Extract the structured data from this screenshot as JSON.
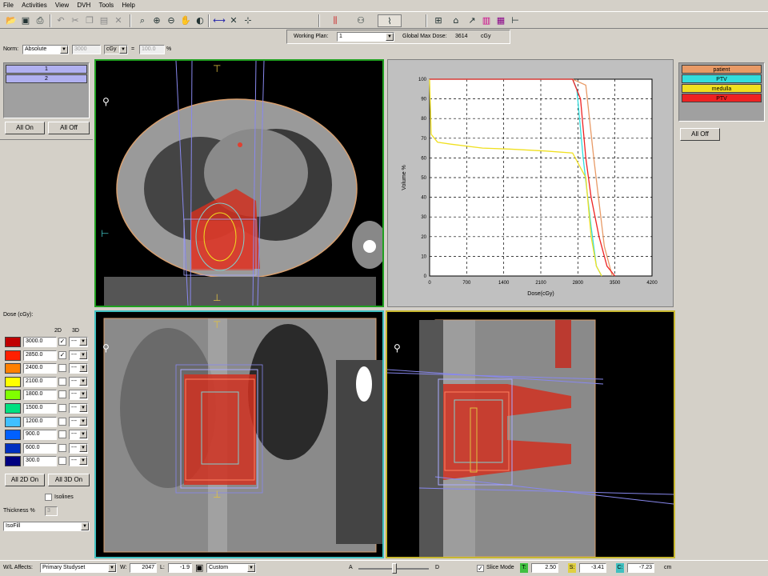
{
  "menu": [
    "File",
    "Activities",
    "View",
    "DVH",
    "Tools",
    "Help"
  ],
  "toolbar": {
    "icons": [
      "open-icon",
      "save-icon",
      "print-icon",
      "undo-icon",
      "cut-icon",
      "copy-icon",
      "paste-icon",
      "delete-icon",
      "zoom-icon",
      "zoom-in-icon",
      "zoom-out-icon",
      "pan-icon",
      "window-level-icon",
      "measure-icon",
      "crosshair-icon",
      "poi-icon"
    ],
    "working_plan_label": "Working Plan:",
    "working_plan_value": "1",
    "global_max_dose_label": "Global Max Dose:",
    "global_max_dose_value": "3614",
    "global_max_dose_unit": "cGy"
  },
  "norm": {
    "label": "Norm:",
    "mode": "Absolute",
    "value": "3000",
    "unit": "cGy",
    "equals": "=",
    "percent": "100.0",
    "percent_sign": "%"
  },
  "beams": {
    "items": [
      "1",
      "2"
    ],
    "all_on": "All On",
    "all_off": "All Off"
  },
  "dvh": {
    "legend": [
      {
        "label": "patient",
        "color": "#e89a66"
      },
      {
        "label": "PTV",
        "color": "#33dddd"
      },
      {
        "label": "medulla",
        "color": "#f0e020"
      },
      {
        "label": "PTV",
        "color": "#ee2222"
      }
    ],
    "all_off": "All Off"
  },
  "chart_data": {
    "type": "line",
    "xlabel": "Dose(cGy)",
    "ylabel": "Volume %",
    "xlim": [
      0,
      4200
    ],
    "ylim": [
      0,
      100
    ],
    "xticks": [
      "0",
      "700",
      "1400",
      "2100",
      "2800",
      "3500",
      "4200"
    ],
    "yticks": [
      "0",
      "10",
      "20",
      "30",
      "40",
      "50",
      "60",
      "70",
      "80",
      "90",
      "100"
    ],
    "grid": true,
    "series": [
      {
        "name": "patient",
        "color": "#e89a66",
        "x": [
          0,
          2700,
          2950,
          3100,
          3300,
          3450
        ],
        "y": [
          100,
          100,
          97,
          60,
          15,
          0
        ]
      },
      {
        "name": "PTV",
        "color": "#33dddd",
        "x": [
          0,
          2700,
          2780,
          2900,
          3050,
          3150,
          3250
        ],
        "y": [
          100,
          100,
          95,
          60,
          25,
          5,
          0
        ]
      },
      {
        "name": "medulla",
        "color": "#f0e020",
        "x": [
          0,
          30,
          150,
          400,
          1000,
          1500,
          2200,
          2700,
          2950,
          3050,
          3150,
          3250
        ],
        "y": [
          100,
          72,
          68,
          67,
          65,
          64.5,
          63.5,
          62.5,
          50,
          20,
          5,
          0
        ]
      },
      {
        "name": "PTV",
        "color": "#ee2222",
        "x": [
          0,
          2700,
          2850,
          2950,
          3050,
          3200,
          3350,
          3500
        ],
        "y": [
          100,
          100,
          90,
          60,
          40,
          20,
          5,
          0
        ]
      }
    ]
  },
  "dose_panel": {
    "title": "Dose (cGy):",
    "col_2d": "2D",
    "col_3d": "3D",
    "levels": [
      {
        "value": "3000.0",
        "color": "#c00000",
        "on2d": "✓"
      },
      {
        "value": "2850.0",
        "color": "#ff2000",
        "on2d": "✓"
      },
      {
        "value": "2400.0",
        "color": "#ff8000",
        "on2d": ""
      },
      {
        "value": "2100.0",
        "color": "#ffff00",
        "on2d": ""
      },
      {
        "value": "1800.0",
        "color": "#80ff00",
        "on2d": ""
      },
      {
        "value": "1500.0",
        "color": "#00e080",
        "on2d": ""
      },
      {
        "value": "1200.0",
        "color": "#40c0ff",
        "on2d": ""
      },
      {
        "value": "900.0",
        "color": "#0060ff",
        "on2d": ""
      },
      {
        "value": "600.0",
        "color": "#0030c0",
        "on2d": ""
      },
      {
        "value": "300.0",
        "color": "#000080",
        "on2d": ""
      }
    ],
    "sel_value": "---",
    "all_2d_on": "All 2D On",
    "all_3d_on": "All 3D On",
    "isolines": "Isolines",
    "thickness_label": "Thickness %",
    "thickness_value": "3",
    "display_mode": "IsoFill"
  },
  "statusbar": {
    "wl_label": "W/L Affects:",
    "wl_value": "Primary Studyset",
    "w_label": "W:",
    "w_value": "2047",
    "l_label": "L:",
    "l_value": "-1.9",
    "preset": "Custom",
    "slider_a": "A",
    "slider_d": "D",
    "slice_mode": "Slice Mode",
    "t_label": "T:",
    "t_value": "2.50",
    "s_label": "S:",
    "s_value": "-3.41",
    "c_label": "C:",
    "c_value": "-7.23",
    "unit": "cm"
  }
}
